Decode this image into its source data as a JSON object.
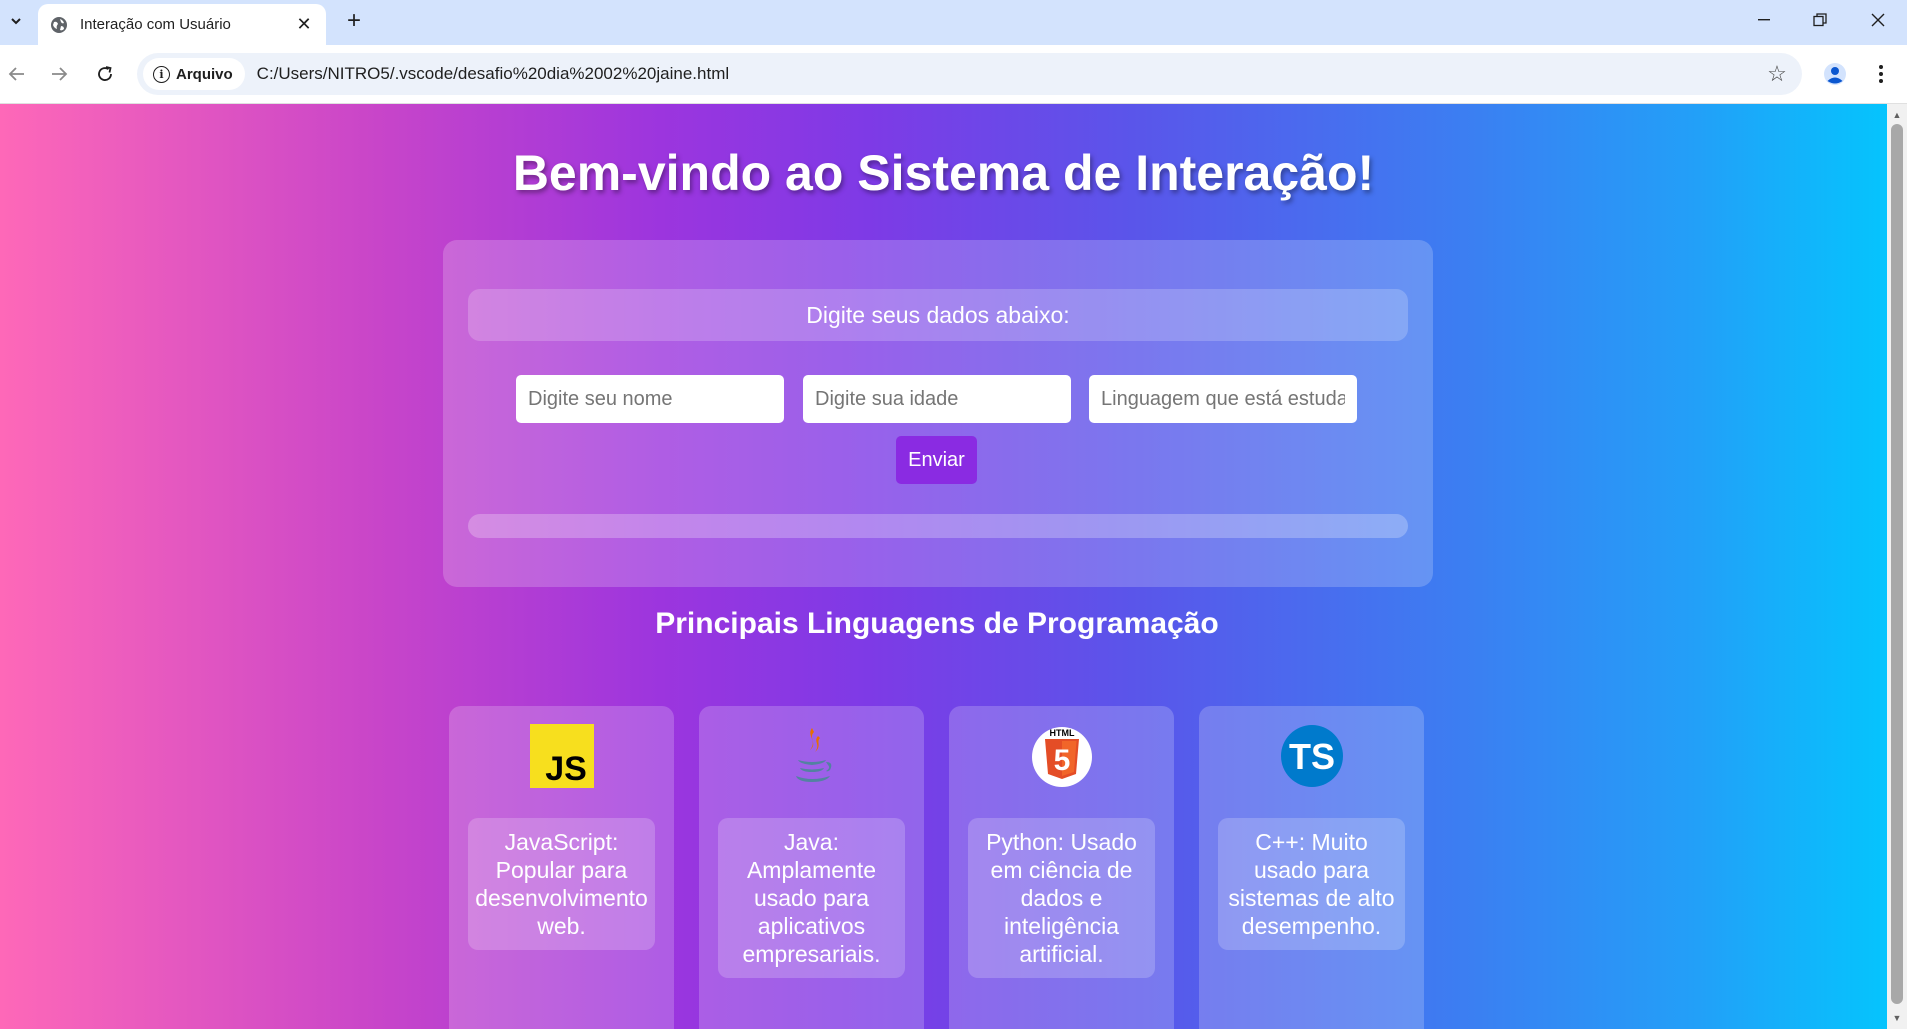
{
  "browser": {
    "tab_title": "Interação com Usuário",
    "chip_label": "Arquivo",
    "url": "C:/Users/NITRO5/.vscode/desafio%20dia%2002%20jaine.html"
  },
  "page": {
    "title": "Bem-vindo ao Sistema de Interação!",
    "form": {
      "heading": "Digite seus dados abaixo:",
      "name_placeholder": "Digite seu nome",
      "age_placeholder": "Digite sua idade",
      "language_placeholder": "Linguagem que está estudando",
      "submit_label": "Enviar"
    },
    "languages_title": "Principais Linguagens de Programação",
    "languages": [
      {
        "icon": "javascript-logo-icon",
        "description": "JavaScript: Popular para desenvolvimento web."
      },
      {
        "icon": "java-logo-icon",
        "description": "Java: Amplamente usado para aplicativos empresariais."
      },
      {
        "icon": "html5-logo-icon",
        "description": "Python: Usado em ciência de dados e inteligência artificial."
      },
      {
        "icon": "typescript-logo-icon",
        "description": "C++: Muito usado para sistemas de alto desempenho."
      }
    ],
    "logo_text": {
      "js": "JS",
      "html": "HTML",
      "html_number": "5",
      "ts": "TS"
    },
    "colors": {
      "gradient_left": "#fe68b8",
      "gradient_mid": "#8a2be2",
      "gradient_right": "#05c4fd",
      "button": "#8a2be2"
    }
  }
}
